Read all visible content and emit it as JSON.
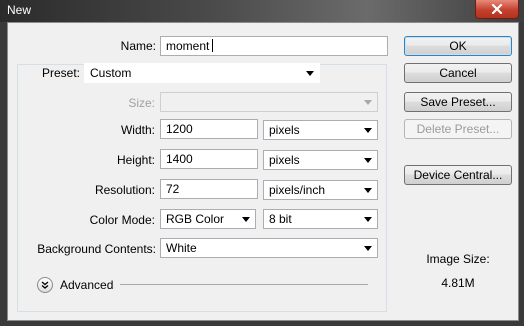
{
  "window": {
    "title": "New"
  },
  "name": {
    "label": "Name:",
    "value": "moment"
  },
  "preset": {
    "label": "Preset:",
    "value": "Custom"
  },
  "size": {
    "label": "Size:",
    "value": ""
  },
  "width": {
    "label": "Width:",
    "value": "1200",
    "unit": "pixels"
  },
  "height": {
    "label": "Height:",
    "value": "1400",
    "unit": "pixels"
  },
  "resolution": {
    "label": "Resolution:",
    "value": "72",
    "unit": "pixels/inch"
  },
  "color_mode": {
    "label": "Color Mode:",
    "mode": "RGB Color",
    "depth": "8 bit"
  },
  "background": {
    "label": "Background Contents:",
    "value": "White"
  },
  "advanced": {
    "label": "Advanced"
  },
  "buttons": {
    "ok": "OK",
    "cancel": "Cancel",
    "save_preset": "Save Preset...",
    "delete_preset": "Delete Preset...",
    "device_central": "Device Central..."
  },
  "image_size": {
    "label": "Image Size:",
    "value": "4.81M"
  },
  "icons": {
    "close": "close-icon",
    "expand": "chevron-double-down-icon",
    "dropdown": "chevron-down-icon"
  },
  "colors": {
    "default_button_border": "#3c7fb1",
    "close_button": "#c4412e"
  }
}
